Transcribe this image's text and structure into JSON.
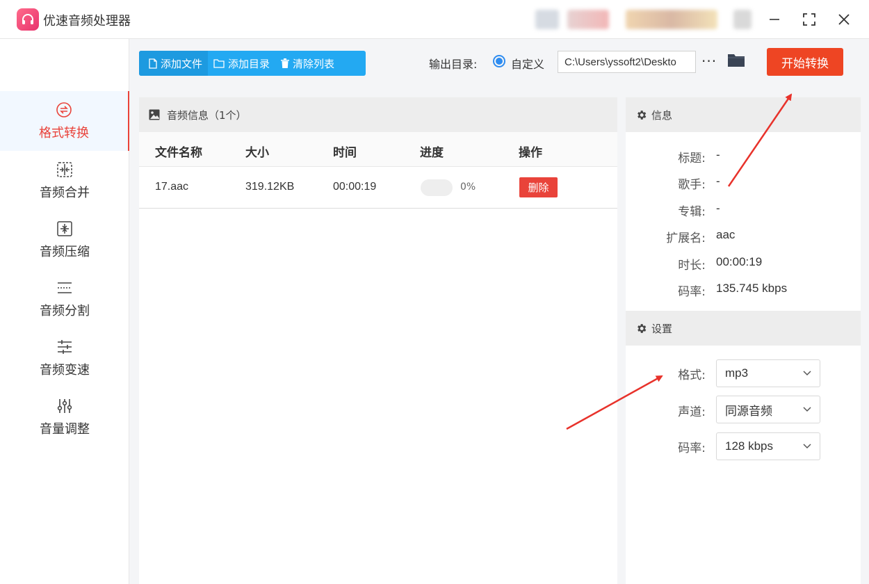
{
  "app": {
    "title": "优速音频处理器"
  },
  "sidebar": {
    "items": [
      {
        "label": "格式转换",
        "icon": "format-convert-icon",
        "active": true
      },
      {
        "label": "音频合并",
        "icon": "merge-icon",
        "active": false
      },
      {
        "label": "音频压缩",
        "icon": "compress-icon",
        "active": false
      },
      {
        "label": "音频分割",
        "icon": "split-icon",
        "active": false
      },
      {
        "label": "音频变速",
        "icon": "speed-icon",
        "active": false
      },
      {
        "label": "音量调整",
        "icon": "volume-icon",
        "active": false
      }
    ]
  },
  "toolbar": {
    "add_file": "添加文件",
    "add_folder": "添加目录",
    "clear_list": "清除列表",
    "output_label": "输出目录:",
    "radio_label": "自定义",
    "output_path": "C:\\Users\\yssoft2\\Deskto",
    "more": "···",
    "start": "开始转换"
  },
  "file_list": {
    "header": "音频信息（1个）",
    "columns": [
      "文件名称",
      "大小",
      "时间",
      "进度",
      "操作"
    ],
    "rows": [
      {
        "name": "17.aac",
        "size": "319.12KB",
        "time": "00:00:19",
        "progress": 0,
        "progress_text": "0%",
        "action": "删除"
      }
    ]
  },
  "info": {
    "header": "信息",
    "fields": [
      {
        "label": "标题:",
        "value": "-"
      },
      {
        "label": "歌手:",
        "value": "-"
      },
      {
        "label": "专辑:",
        "value": "-"
      },
      {
        "label": "扩展名:",
        "value": "aac"
      },
      {
        "label": "时长:",
        "value": "00:00:19"
      },
      {
        "label": "码率:",
        "value": "135.745 kbps"
      }
    ]
  },
  "settings": {
    "header": "设置",
    "fields": [
      {
        "label": "格式:",
        "value": "mp3"
      },
      {
        "label": "声道:",
        "value": "同源音频"
      },
      {
        "label": "码率:",
        "value": "128 kbps"
      }
    ]
  },
  "colors": {
    "accent": "#ee4523",
    "toolbar": "#23a9f2",
    "active_nav": "#e9433a"
  }
}
